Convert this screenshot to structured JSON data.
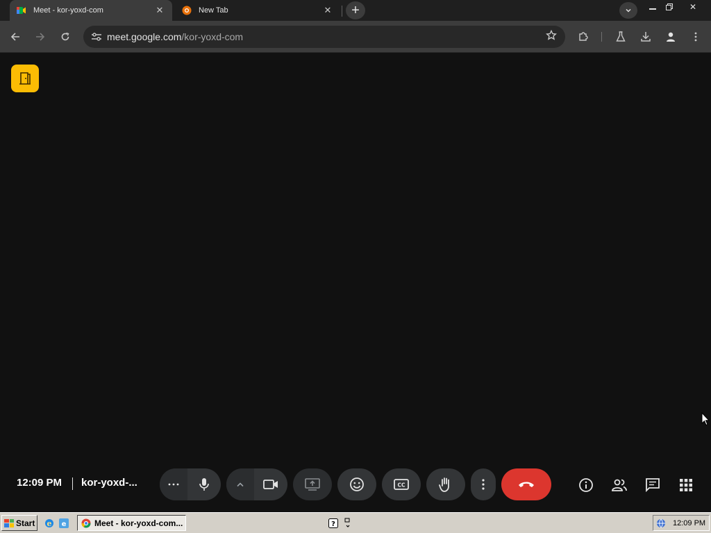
{
  "browser": {
    "tabs": [
      {
        "title": "Meet - kor-yoxd-com",
        "active": true,
        "favicon": "google-meet-icon"
      },
      {
        "title": "New Tab",
        "active": false,
        "favicon": "browser-logo-icon"
      }
    ],
    "address": {
      "host": "meet.google.com",
      "path": "/kor-yoxd-com"
    }
  },
  "meeting": {
    "time": "12:09 PM",
    "code": "kor-yoxd-...",
    "controls": [
      "more-options-icon",
      "microphone-icon",
      "chevron-up-icon",
      "camera-icon",
      "present-screen-icon",
      "emoji-icon",
      "captions-icon",
      "raise-hand-icon",
      "more-vert-icon",
      "end-call-icon"
    ],
    "captions_label": "CC",
    "side_controls": [
      "info-icon",
      "people-icon",
      "chat-icon",
      "activities-icon"
    ]
  },
  "taskbar": {
    "start_label": "Start",
    "task_item": "Meet - kor-yoxd-com...",
    "clock": "12:09 PM"
  },
  "colors": {
    "stage_bg": "#111111",
    "control_bg": "#333537",
    "end_call": "#dc362e",
    "door_badge": "#fbbc04",
    "toolbar": "#3c3c3c",
    "tabstrip": "#1f1f1f"
  }
}
